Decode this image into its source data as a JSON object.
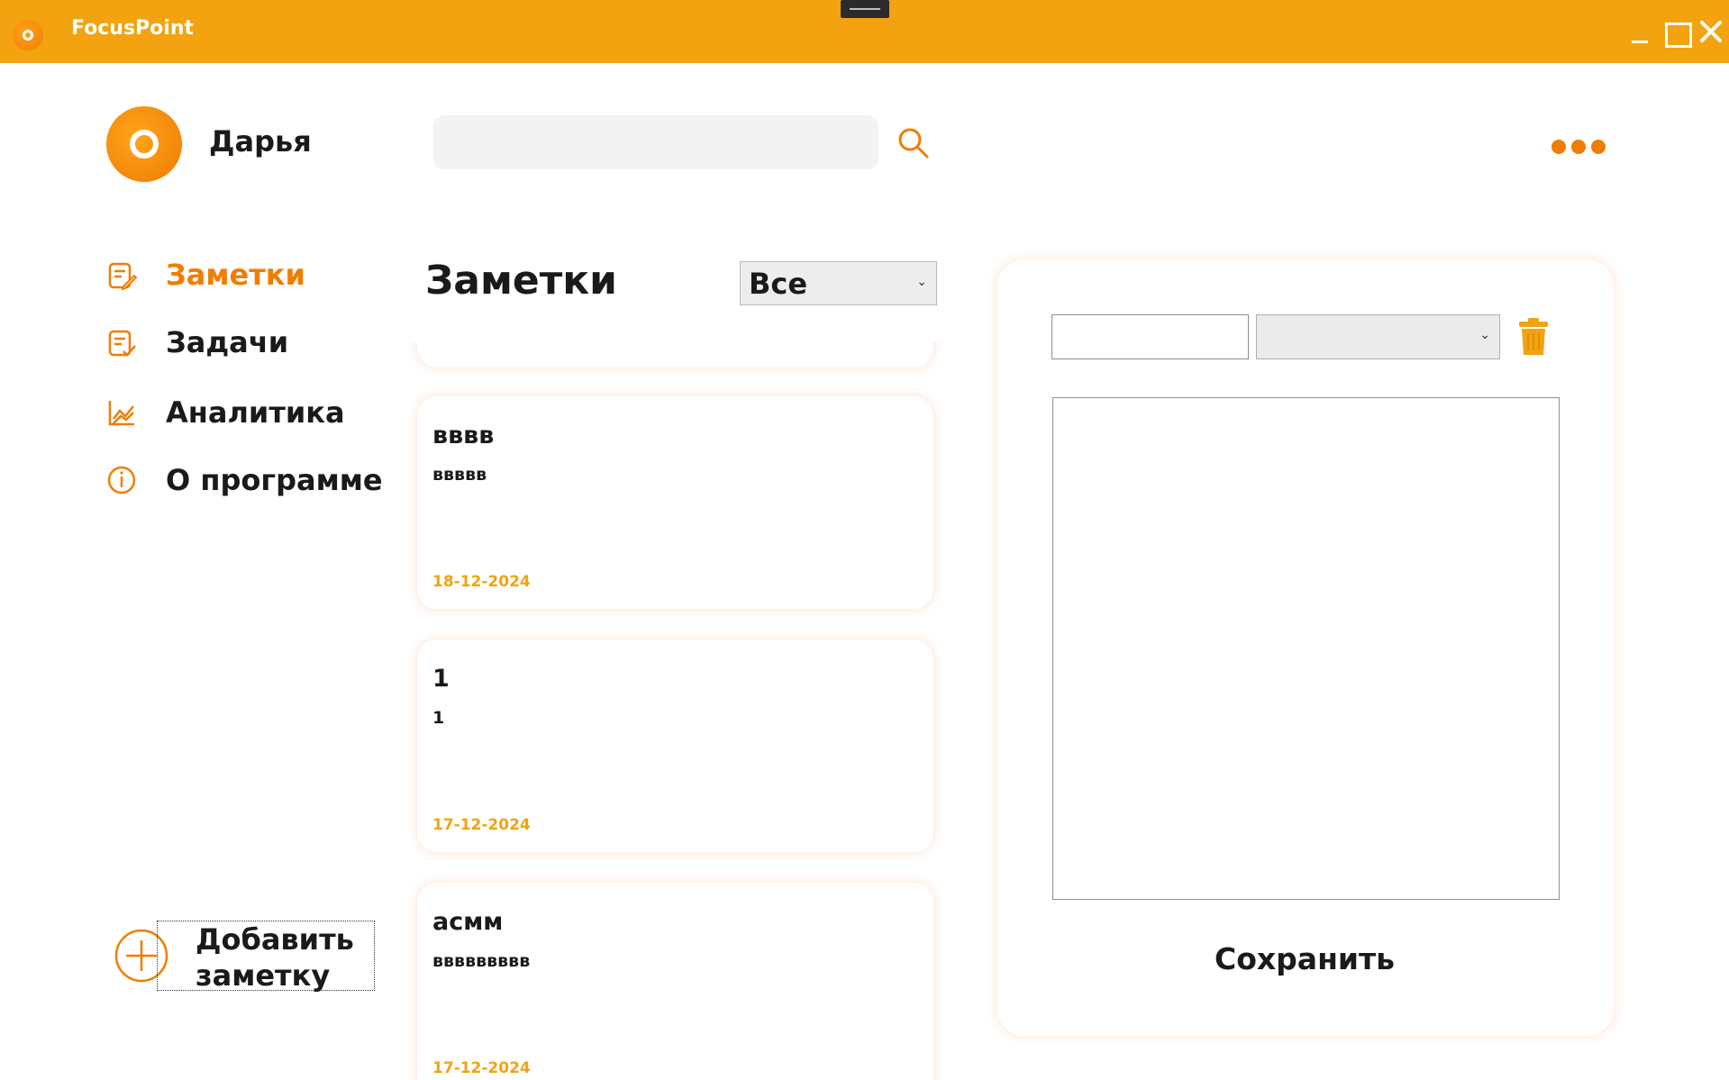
{
  "window": {
    "title": "FocusPoint"
  },
  "user": {
    "name": "Дарья"
  },
  "search": {
    "value": "",
    "placeholder": ""
  },
  "nav": [
    {
      "label": "Заметки",
      "icon": "notes-icon",
      "active": true
    },
    {
      "label": "Задачи",
      "icon": "tasks-icon",
      "active": false
    },
    {
      "label": "Аналитика",
      "icon": "analytics-icon",
      "active": false
    },
    {
      "label": "О программе",
      "icon": "info-icon",
      "active": false
    }
  ],
  "add_note": {
    "label": "Добавить заметку",
    "icon": "plus-circle-icon"
  },
  "notes_list": {
    "title": "Заметки",
    "filter_value": "Все",
    "cards": [
      {
        "title": "вввв",
        "body": "ввввв",
        "date": "18-12-2024"
      },
      {
        "title": "1",
        "body": "1",
        "date": "17-12-2024"
      },
      {
        "title": "асмм",
        "body": "ввввввввв",
        "date": "17-12-2024"
      }
    ]
  },
  "editor": {
    "title_value": "",
    "category_value": "",
    "content_value": "",
    "save_label": "Сохранить"
  },
  "colors": {
    "titlebar": "#f2a30f",
    "accent": "#f07d00",
    "date": "#f2a30f"
  }
}
